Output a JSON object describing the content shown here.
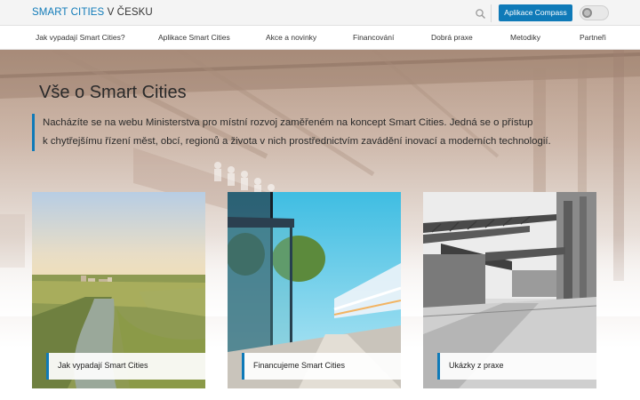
{
  "header": {
    "brand_part1": "SMART CITIES",
    "brand_part2": "V ČESKU",
    "compass_button": "Aplikace Compass"
  },
  "nav": {
    "items": [
      "Jak vypadají Smart Cities?",
      "Aplikace Smart Cities",
      "Akce a novinky",
      "Financování",
      "Dobrá praxe",
      "Metodiky",
      "Partneři"
    ]
  },
  "hero": {
    "title": "Vše o Smart Cities",
    "lead_line1": "Nacházíte se na webu Ministerstva pro místní rozvoj zaměřeném na koncept Smart Cities. Jedná se o přístup",
    "lead_line2": "k chytřejšímu řízení měst, obcí, regionů a života v nich prostřednictvím zavádění inovací a moderních technologií."
  },
  "cards": [
    {
      "label": "Jak vypadají Smart Cities"
    },
    {
      "label": "Financujeme Smart Cities"
    },
    {
      "label": "Ukázky z praxe"
    }
  ],
  "colors": {
    "accent": "#0f7ab8",
    "topbar_bg": "#f4f4f4"
  },
  "icons": {
    "search": "search-icon",
    "toggle": "toggle-icon"
  }
}
